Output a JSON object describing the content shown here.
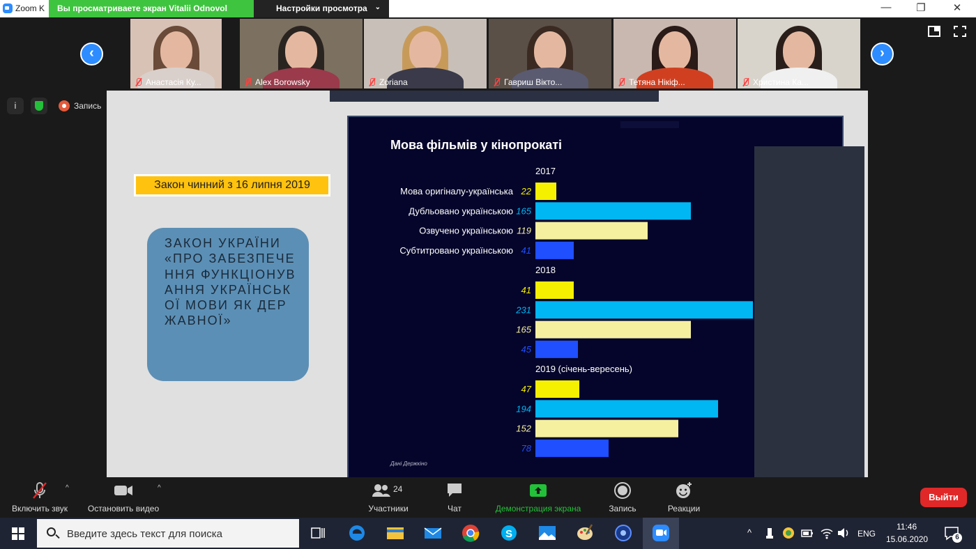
{
  "titlebar": {
    "app_title": "Zoom K",
    "share_banner": "Вы просматриваете экран Vitalii Odnovol",
    "view_options": "Настройки просмотра"
  },
  "participants": [
    {
      "name": "Анастасія Ку...",
      "color": "#d8c2b6",
      "hair": "#6a4a38",
      "body": "#d9d0cb"
    },
    {
      "name": "Alex Borowsky",
      "color": "#7c7060",
      "hair": "#2a2420",
      "body": "#9a3a4a"
    },
    {
      "name": "Zoriana",
      "color": "#c8c0b8",
      "hair": "#c89a5a",
      "body": "#3a3a4a"
    },
    {
      "name": "Гавриш Вікто...",
      "color": "#5a5048",
      "hair": "#3a2a22",
      "body": "#5a5a70"
    },
    {
      "name": "Тетяна Нікіф...",
      "color": "#c8b8b0",
      "hair": "#2a1a18",
      "body": "#d04020"
    },
    {
      "name": "Христина Ка...",
      "color": "#d8d4cc",
      "hair": "#2a1e1a",
      "body": "#f0f0f0"
    }
  ],
  "status": {
    "record_label": "Запись"
  },
  "slide": {
    "law_date": "Закон чинний з 16 липня 2019",
    "law_title": "ЗАКОН УКРАЇНИ «ПРО ЗАБЕЗПЕЧЕННЯ ФУНКЦІОНУВАННЯ УКРАЇНСЬКОЇ МОВИ ЯК ДЕРЖАВНОЇ»"
  },
  "chart_data": {
    "type": "bar",
    "orientation": "horizontal",
    "title": "Мова фільмів у кінопрокаті",
    "source": "Дані Держкіно",
    "categories": [
      "Мова оригіналу-українська",
      "Дубльовано українською",
      "Озвучено українською",
      "Субтитровано українською"
    ],
    "colors": [
      "#f5ef00",
      "#00b7f3",
      "#f5f0a0",
      "#1f4fff"
    ],
    "groups": [
      {
        "label": "2017",
        "values": [
          22,
          165,
          119,
          41
        ]
      },
      {
        "label": "2018",
        "values": [
          41,
          231,
          165,
          45
        ]
      },
      {
        "label": "2019 (січень-вересень)",
        "values": [
          47,
          194,
          152,
          78
        ]
      }
    ]
  },
  "toolbar": {
    "unmute": "Включить звук",
    "stop_video": "Остановить видео",
    "participants": "Участники",
    "participants_count": "24",
    "chat": "Чат",
    "share_screen": "Демонстрация экрана",
    "record": "Запись",
    "reactions": "Реакции",
    "leave": "Выйти"
  },
  "taskbar": {
    "search_placeholder": "Введите здесь текст для поиска",
    "lang": "ENG",
    "time": "11:46",
    "date": "15.06.2020",
    "notifications": "6"
  }
}
